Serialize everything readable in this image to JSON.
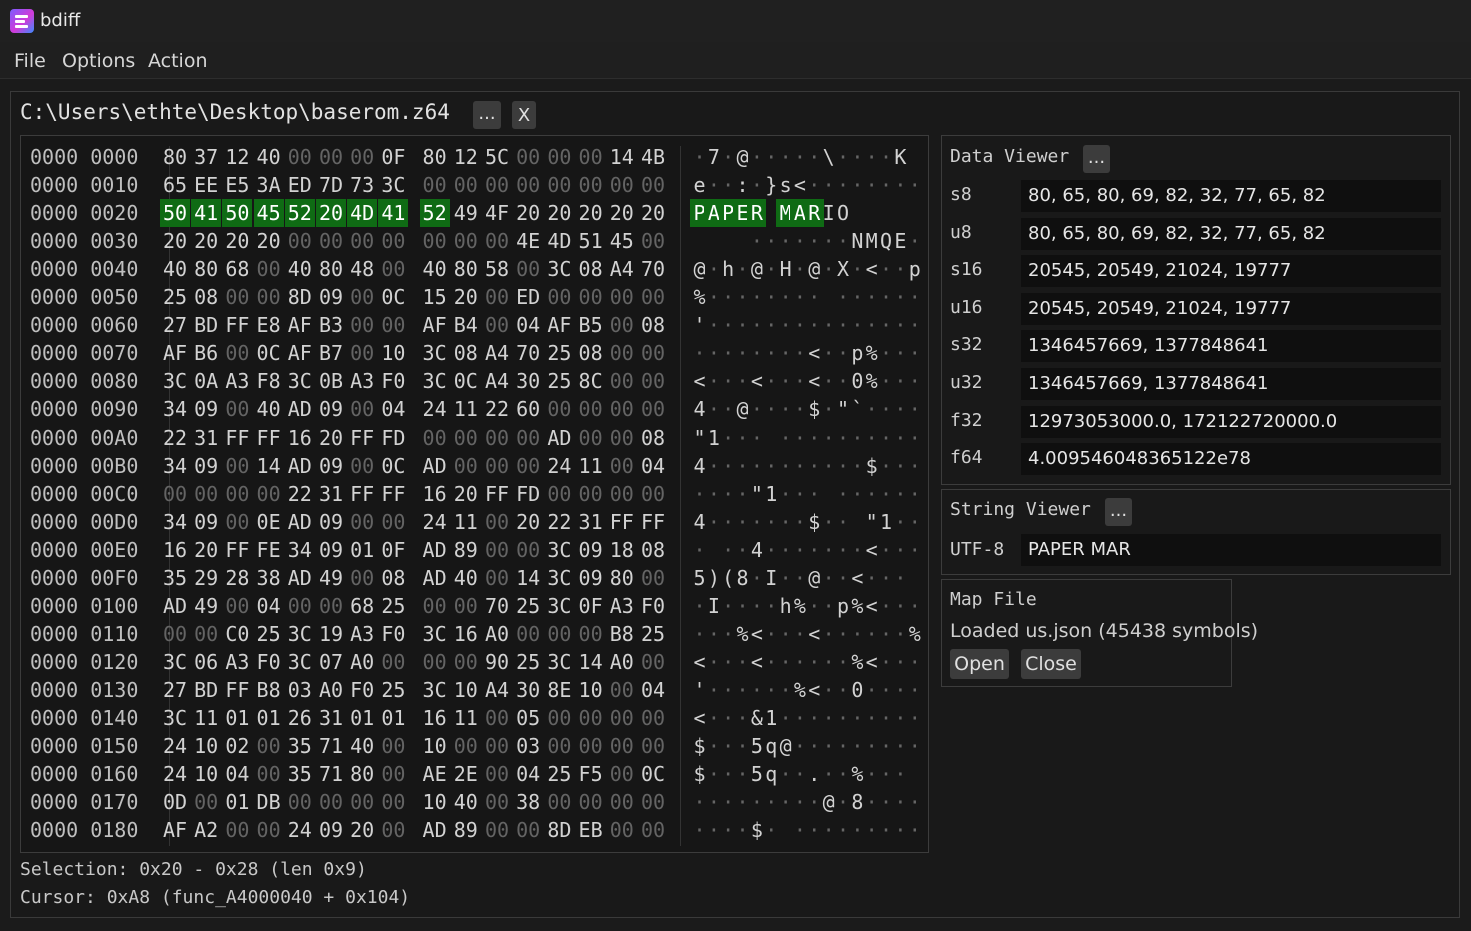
{
  "window": {
    "title": "bdiff"
  },
  "menu": [
    "File",
    "Options",
    "Action"
  ],
  "file": {
    "path": "C:\\Users\\ethte\\Desktop\\baserom.z64",
    "browse_label": "...",
    "close_label": "X"
  },
  "hex": {
    "selection": {
      "start": 32,
      "end": 40
    },
    "rows": [
      {
        "addr": "0000 0000",
        "bytes": "80 37 12 40 00 00 00 0F 80 12 5C 00 00 00 14 4B",
        "ascii": "·7·@·····\\····K"
      },
      {
        "addr": "0000 0010",
        "bytes": "65 EE E5 3A ED 7D 73 3C 00 00 00 00 00 00 00 00",
        "ascii": "e··:·}s<········"
      },
      {
        "addr": "0000 0020",
        "bytes": "50 41 50 45 52 20 4D 41 52 49 4F 20 20 20 20 20",
        "ascii": "PAPER MARIO     "
      },
      {
        "addr": "0000 0030",
        "bytes": "20 20 20 20 00 00 00 00 00 00 00 4E 4D 51 45 00",
        "ascii": "    ·······NMQE·"
      },
      {
        "addr": "0000 0040",
        "bytes": "40 80 68 00 40 80 48 00 40 80 58 00 3C 08 A4 70",
        "ascii": "@·h·@·H·@·X·<··p"
      },
      {
        "addr": "0000 0050",
        "bytes": "25 08 00 00 8D 09 00 0C 15 20 00 ED 00 00 00 00",
        "ascii": "%········ ······"
      },
      {
        "addr": "0000 0060",
        "bytes": "27 BD FF E8 AF B3 00 00 AF B4 00 04 AF B5 00 08",
        "ascii": "'···············"
      },
      {
        "addr": "0000 0070",
        "bytes": "AF B6 00 0C AF B7 00 10 3C 08 A4 70 25 08 00 00",
        "ascii": "········<··p%···"
      },
      {
        "addr": "0000 0080",
        "bytes": "3C 0A A3 F8 3C 0B A3 F0 3C 0C A4 30 25 8C 00 00",
        "ascii": "<···<···<··0%···"
      },
      {
        "addr": "0000 0090",
        "bytes": "34 09 00 40 AD 09 00 04 24 11 22 60 00 00 00 00",
        "ascii": "4··@····$·\"`····"
      },
      {
        "addr": "0000 00A0",
        "bytes": "22 31 FF FF 16 20 FF FD 00 00 00 00 AD 00 00 08",
        "ascii": "\"1··· ··········"
      },
      {
        "addr": "0000 00B0",
        "bytes": "34 09 00 14 AD 09 00 0C AD 00 00 00 24 11 00 04",
        "ascii": "4···········$···"
      },
      {
        "addr": "0000 00C0",
        "bytes": "00 00 00 00 22 31 FF FF 16 20 FF FD 00 00 00 00",
        "ascii": "····\"1··· ······"
      },
      {
        "addr": "0000 00D0",
        "bytes": "34 09 00 0E AD 09 00 00 24 11 00 20 22 31 FF FF",
        "ascii": "4·······$·· \"1··"
      },
      {
        "addr": "0000 00E0",
        "bytes": "16 20 FF FE 34 09 01 0F AD 89 00 00 3C 09 18 08",
        "ascii": "· ··4·······<···"
      },
      {
        "addr": "0000 00F0",
        "bytes": "35 29 28 38 AD 49 00 08 AD 40 00 14 3C 09 80 00",
        "ascii": "5)(8·I··@··<···"
      },
      {
        "addr": "0000 0100",
        "bytes": "AD 49 00 04 00 00 68 25 00 00 70 25 3C 0F A3 F0",
        "ascii": "·I····h%··p%<···"
      },
      {
        "addr": "0000 0110",
        "bytes": "00 00 C0 25 3C 19 A3 F0 3C 16 A0 00 00 00 B8 25",
        "ascii": "···%<···<······%"
      },
      {
        "addr": "0000 0120",
        "bytes": "3C 06 A3 F0 3C 07 A0 00 00 00 90 25 3C 14 A0 00",
        "ascii": "<···<······%<···"
      },
      {
        "addr": "0000 0130",
        "bytes": "27 BD FF B8 03 A0 F0 25 3C 10 A4 30 8E 10 00 04",
        "ascii": "'······%<··0····"
      },
      {
        "addr": "0000 0140",
        "bytes": "3C 11 01 01 26 31 01 01 16 11 00 05 00 00 00 00",
        "ascii": "<···&1··········"
      },
      {
        "addr": "0000 0150",
        "bytes": "24 10 02 00 35 71 40 00 10 00 00 03 00 00 00 00",
        "ascii": "$···5q@·········"
      },
      {
        "addr": "0000 0160",
        "bytes": "24 10 04 00 35 71 80 00 AE 2E 00 04 25 F5 00 0C",
        "ascii": "$···5q··.··%···"
      },
      {
        "addr": "0000 0170",
        "bytes": "0D 00 01 DB 00 00 00 00 10 40 00 38 00 00 00 00",
        "ascii": "·········@·8····"
      },
      {
        "addr": "0000 0180",
        "bytes": "AF A2 00 00 24 09 20 00 AD 89 00 00 8D EB 00 00",
        "ascii": "····$· ·········"
      }
    ]
  },
  "status": {
    "selection": "Selection: 0x20 - 0x28 (len 0x9)",
    "cursor": "Cursor: 0xA8 (func_A4000040 + 0x104)"
  },
  "data_viewer": {
    "title": "Data Viewer",
    "options_label": "...",
    "rows": [
      {
        "label": "s8",
        "value": "80, 65, 80, 69, 82, 32, 77, 65, 82"
      },
      {
        "label": "u8",
        "value": "80, 65, 80, 69, 82, 32, 77, 65, 82"
      },
      {
        "label": "s16",
        "value": "20545, 20549, 21024, 19777"
      },
      {
        "label": "u16",
        "value": "20545, 20549, 21024, 19777"
      },
      {
        "label": "s32",
        "value": "1346457669, 1377848641"
      },
      {
        "label": "u32",
        "value": "1346457669, 1377848641"
      },
      {
        "label": "f32",
        "value": "12973053000.0, 172122720000.0"
      },
      {
        "label": "f64",
        "value": "4.009546048365122e78"
      }
    ]
  },
  "string_viewer": {
    "title": "String Viewer",
    "options_label": "...",
    "encoding": "UTF-8",
    "value": "PAPER MAR"
  },
  "map_file": {
    "title": "Map File",
    "status": "Loaded us.json (45438 symbols)",
    "open_label": "Open",
    "close_label": "Close"
  },
  "colors": {
    "selection": "#0f6b14",
    "background": "#191919",
    "zero_byte": "#646464"
  }
}
